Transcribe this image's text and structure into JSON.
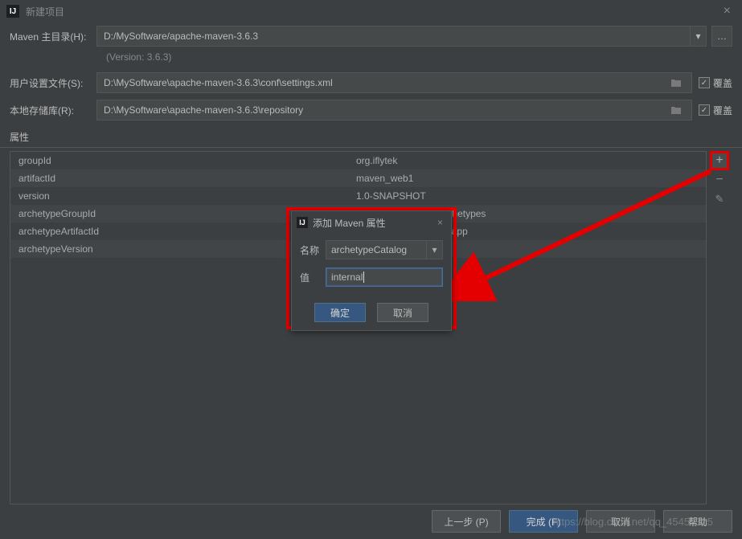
{
  "window": {
    "title": "新建项目",
    "close_icon": "×"
  },
  "fields": {
    "maven_home_label": "Maven 主目录(H):",
    "maven_home_value": "D:/MySoftware/apache-maven-3.6.3",
    "version_note": "(Version: 3.6.3)",
    "user_settings_label": "用户设置文件(S):",
    "user_settings_value": "D:\\MySoftware\\apache-maven-3.6.3\\conf\\settings.xml",
    "local_repo_label": "本地存储库(R):",
    "local_repo_value": "D:\\MySoftware\\apache-maven-3.6.3\\repository",
    "override_label": "覆盖"
  },
  "properties": {
    "title": "属性",
    "rows": [
      {
        "key": "groupId",
        "value": "org.iflytek"
      },
      {
        "key": "artifactId",
        "value": "maven_web1"
      },
      {
        "key": "version",
        "value": "1.0-SNAPSHOT"
      },
      {
        "key": "archetypeGroupId",
        "value": "org.apache.maven.archetypes"
      },
      {
        "key": "archetypeArtifactId",
        "value": "maven-archetype-webapp"
      },
      {
        "key": "archetypeVersion",
        "value": ""
      }
    ]
  },
  "icons": {
    "plus": "+",
    "minus": "−",
    "pencil": "✎",
    "ellipsis": "…",
    "dropdown": "▾",
    "check": "✓"
  },
  "modal": {
    "title": "添加 Maven 属性",
    "name_label": "名称",
    "name_value": "archetypeCatalog",
    "value_label": "值",
    "value_value": "internal",
    "ok": "确定",
    "cancel": "取消",
    "close": "×"
  },
  "footer": {
    "prev": "上一步 (P)",
    "finish": "完成 (F)",
    "cancel": "取消",
    "help": "帮助"
  },
  "watermark": "https://blog.csdn.net/qq_45459315"
}
